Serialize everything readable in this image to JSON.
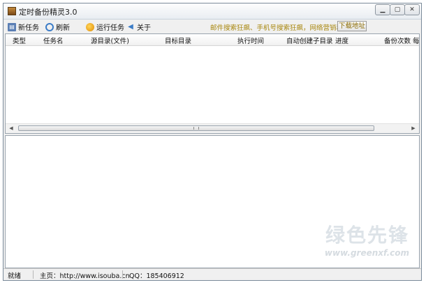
{
  "window": {
    "title": "定时备份精灵3.0"
  },
  "toolbar": {
    "new_task": "新任务",
    "refresh": "刷新",
    "run_task": "运行任务",
    "about": "关于",
    "promo_text": "邮件搜索狂飙、手机号搜索狂飙，网络营销利器",
    "download": "下载地址"
  },
  "task_list": {
    "columns": [
      "类型",
      "任务名",
      "源目录(文件)",
      "目标目录",
      "执行时间",
      "自动创建子目录",
      "进度",
      "备份次数",
      "每"
    ],
    "rows": []
  },
  "watermark": {
    "text": "绿色先锋",
    "url": "www.greenxf.com"
  },
  "status": {
    "state": "就绪",
    "homepage": "主页：http://www.isouba.cn",
    "qq": "QQ：185406912"
  }
}
